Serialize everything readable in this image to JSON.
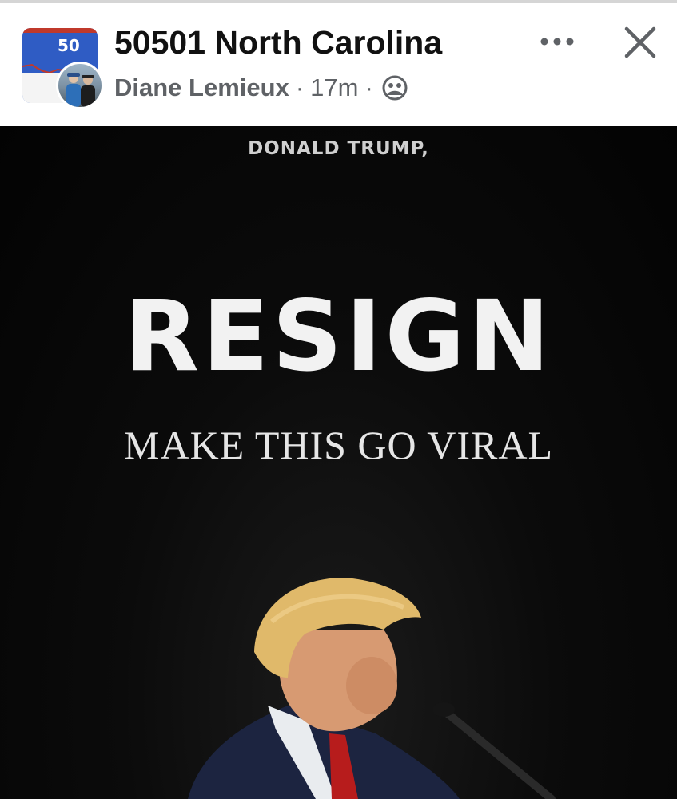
{
  "post_header": {
    "group_name": "50501 North Carolina",
    "group_avatar_text": "50",
    "author": "Diane Lemieux",
    "separator": "·",
    "time_ago": "17m",
    "privacy_icon": "group-privacy-icon",
    "more_icon": "more-options-icon",
    "close_icon": "close-icon"
  },
  "post_image": {
    "subtitle": "DONALD TRUMP,",
    "headline": "RESIGN",
    "tagline": "MAKE THIS GO VIRAL"
  },
  "colors": {
    "header_bg": "#ffffff",
    "text_primary": "#111111",
    "text_secondary": "#5f6266",
    "image_bg": "#050505"
  }
}
